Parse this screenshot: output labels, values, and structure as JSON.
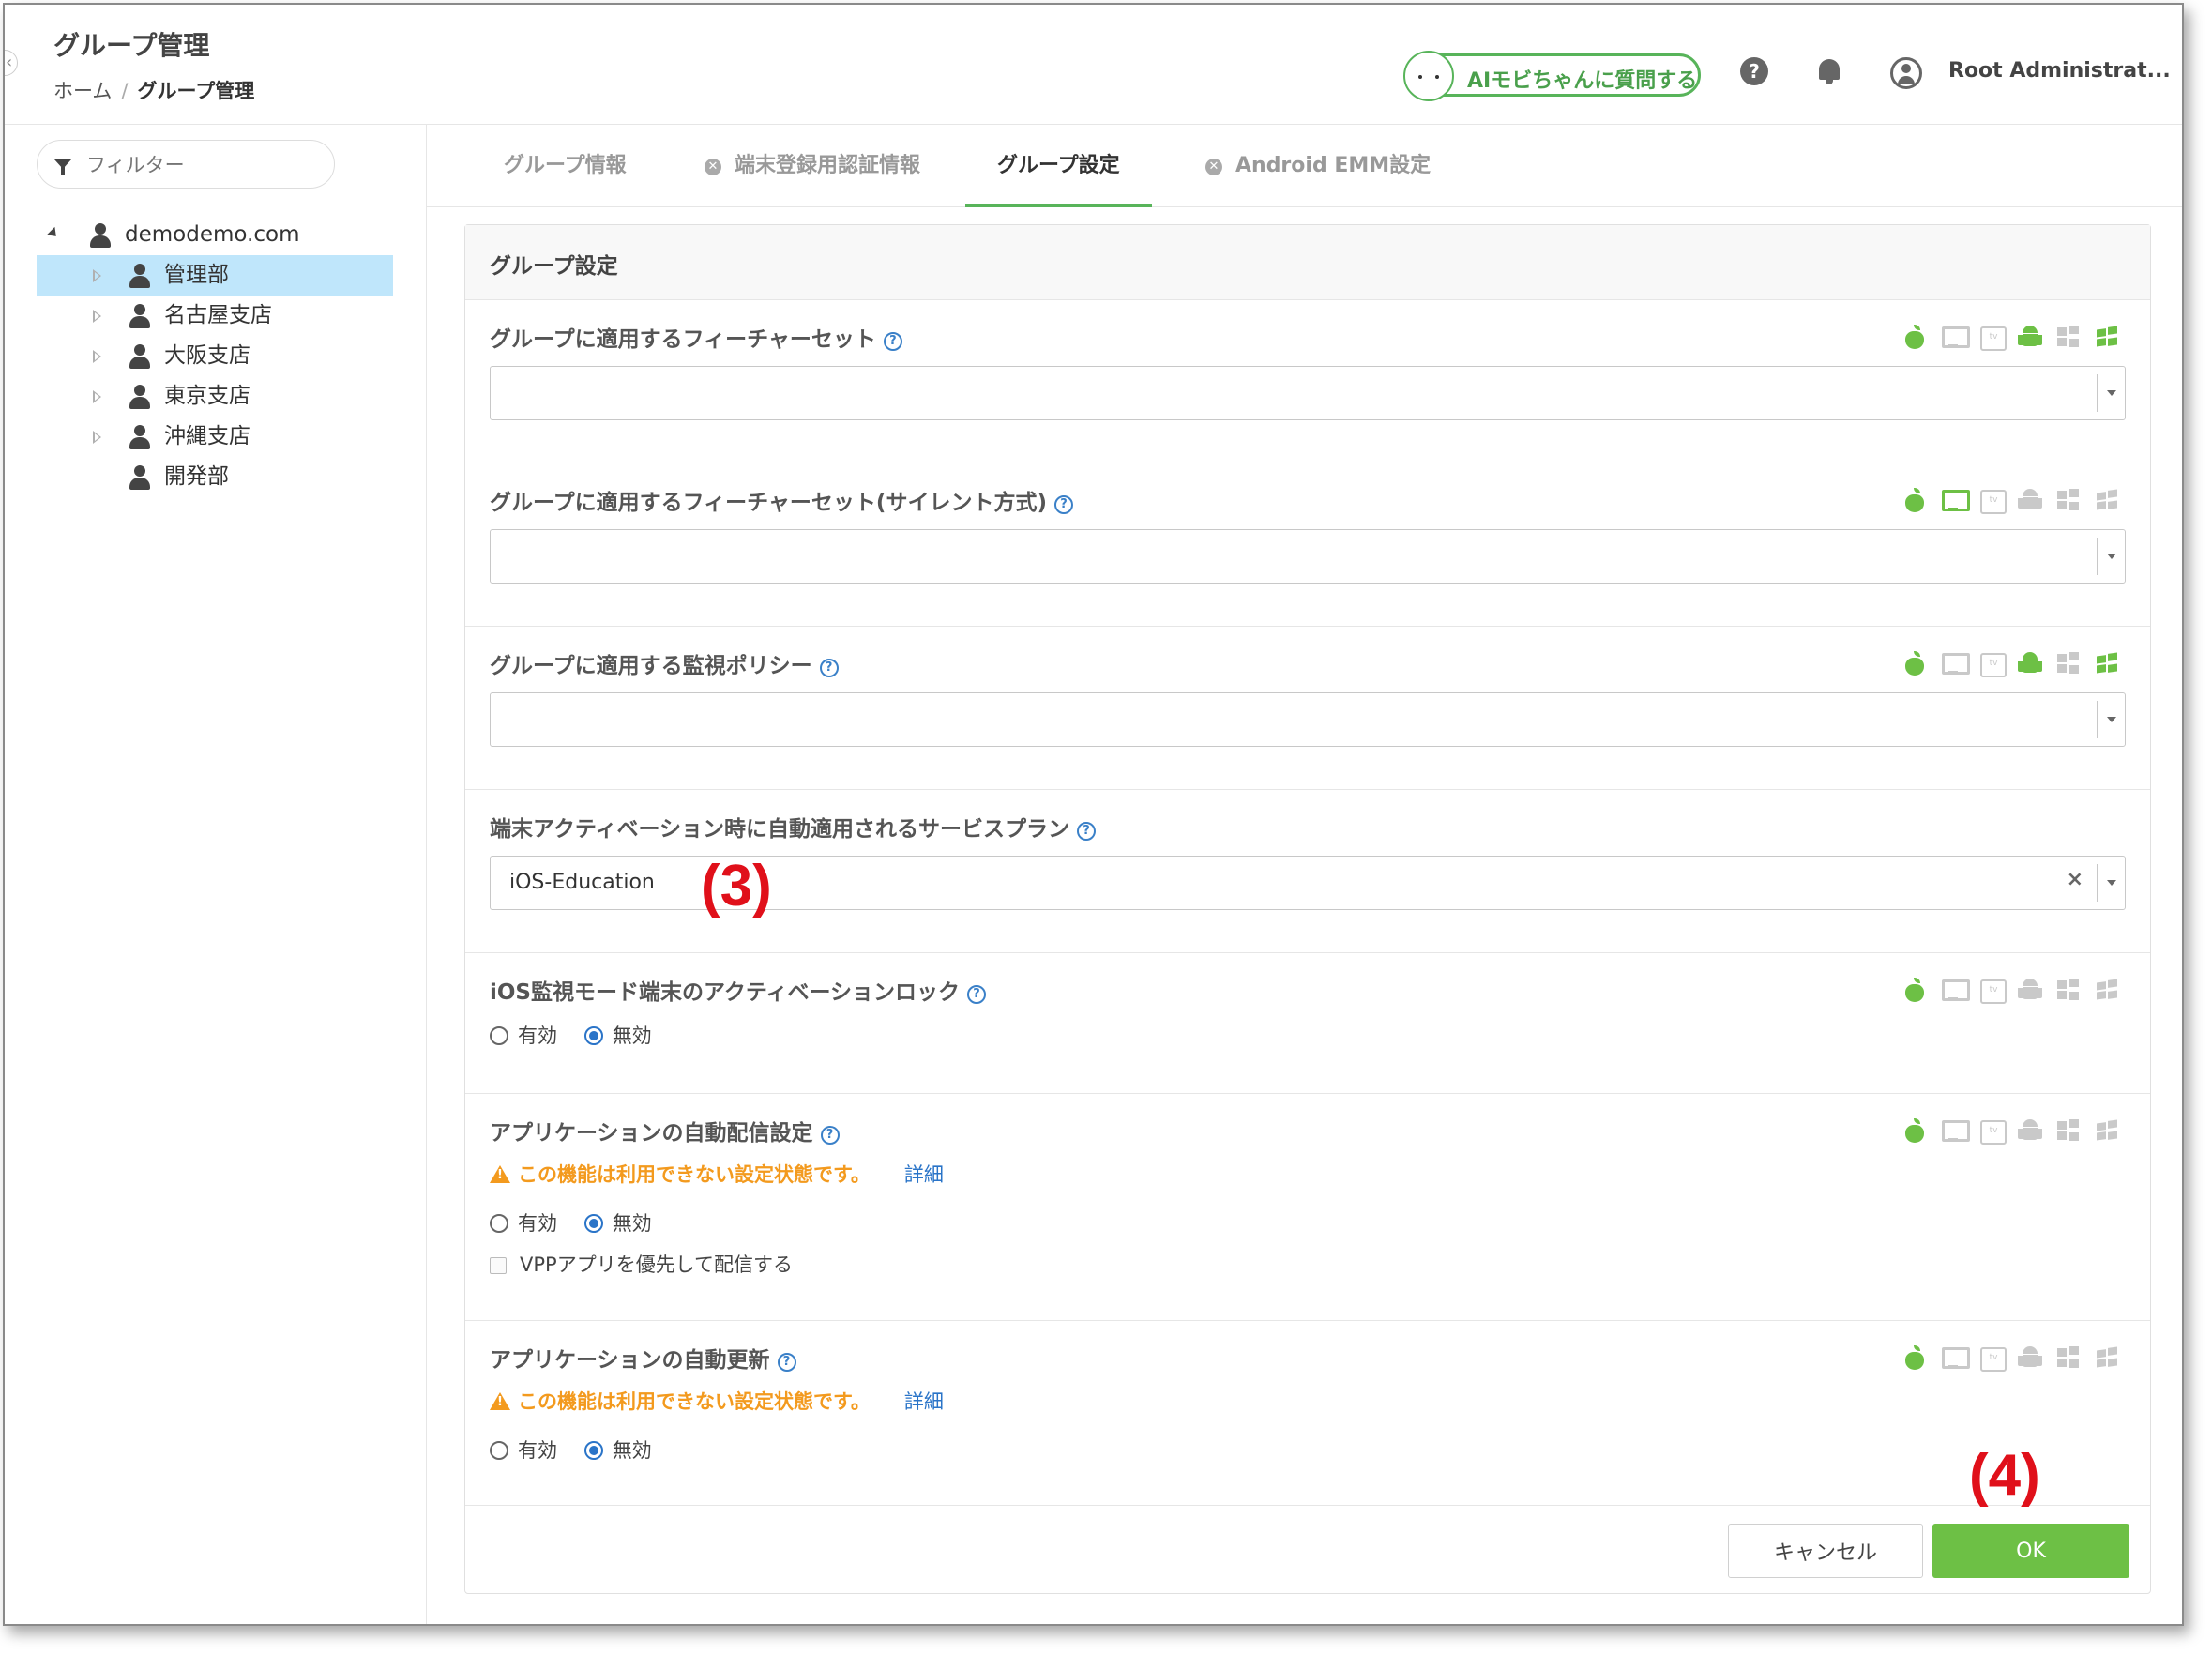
{
  "header": {
    "title": "グループ管理",
    "breadcrumb": {
      "home": "ホーム",
      "separator": "/",
      "current": "グループ管理"
    },
    "ai_button_label": "AIモビちゃんに質問する",
    "user_name": "Root Administrat..."
  },
  "sidebar": {
    "filter_placeholder": "フィルター",
    "tree": {
      "root": "demodemo.com",
      "children": [
        "管理部",
        "名古屋支店",
        "大阪支店",
        "東京支店",
        "沖縄支店",
        "開発部"
      ],
      "selected": "管理部"
    }
  },
  "tabs": [
    {
      "label": "グループ情報",
      "icon": ""
    },
    {
      "label": "端末登録用認証情報",
      "icon": "x-circle-icon"
    },
    {
      "label": "グループ設定",
      "icon": "",
      "active": true
    },
    {
      "label": "Android EMM設定",
      "icon": "x-circle-icon"
    }
  ],
  "panel": {
    "title": "グループ設定",
    "sections": {
      "feature_set": {
        "label": "グループに適用するフィーチャーセット",
        "value": ""
      },
      "feature_set_silent": {
        "label": "グループに適用するフィーチャーセット(サイレント方式)",
        "value": ""
      },
      "monitor_policy": {
        "label": "グループに適用する監視ポリシー",
        "value": ""
      },
      "service_plan": {
        "label": "端末アクティベーション時に自動適用されるサービスプラン",
        "value": "iOS-Education",
        "clear": "×"
      },
      "activation_lock": {
        "label": "iOS監視モード端末のアクティベーションロック",
        "options": [
          "有効",
          "無効"
        ],
        "selected": "無効"
      },
      "auto_distribution": {
        "label": "アプリケーションの自動配信設定",
        "warning": "この機能は利用できない設定状態です。",
        "detail_link": "詳細",
        "options": [
          "有効",
          "無効"
        ],
        "selected": "無効",
        "checkbox_label": "VPPアプリを優先して配信する"
      },
      "auto_update": {
        "label": "アプリケーションの自動更新",
        "warning": "この機能は利用できない設定状態です。",
        "detail_link": "詳細",
        "options": [
          "有効",
          "無効"
        ],
        "selected": "無効"
      }
    },
    "cancel_label": "キャンセル",
    "ok_label": "OK"
  },
  "platform_icons": [
    "apple-icon",
    "macos-icon",
    "apple-tv-icon",
    "android-icon",
    "windows-icon",
    "windows-phone-icon"
  ],
  "colors": {
    "active": "#6dc045",
    "inactive": "#c9c9c9",
    "accent_blue": "#2a74c8",
    "warning": "#f39a1e",
    "annotation": "#e0101a"
  },
  "annotations": {
    "a3": "(3)",
    "a4": "(4)"
  }
}
